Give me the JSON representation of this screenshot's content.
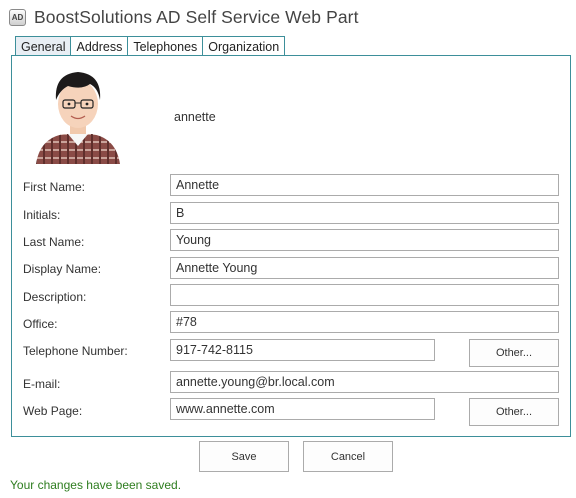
{
  "window": {
    "icon": "app-icon",
    "icon_text": "AD",
    "title": "BoostSolutions AD Self Service Web Part"
  },
  "tabs": [
    {
      "label": "General",
      "active": true
    },
    {
      "label": "Address",
      "active": false
    },
    {
      "label": "Telephones",
      "active": false
    },
    {
      "label": "Organization",
      "active": false
    }
  ],
  "profile": {
    "photo": "user-photo",
    "username": "annette"
  },
  "form": {
    "first_name": {
      "label": "First Name:",
      "value": "Annette"
    },
    "initials": {
      "label": "Initials:",
      "value": "B"
    },
    "last_name": {
      "label": "Last Name:",
      "value": "Young"
    },
    "display_name": {
      "label": "Display Name:",
      "value": "Annette Young"
    },
    "description": {
      "label": "Description:",
      "value": ""
    },
    "office": {
      "label": "Office:",
      "value": "#78"
    },
    "telephone": {
      "label": "Telephone Number:",
      "value": "917-742-8115"
    },
    "email": {
      "label": "E-mail:",
      "value": "annette.young@br.local.com"
    },
    "web_page": {
      "label": "Web Page:",
      "value": "www.annette.com"
    },
    "other_label": "Other..."
  },
  "actions": {
    "save_label": "Save",
    "cancel_label": "Cancel"
  },
  "status": {
    "message": "Your changes have been saved.",
    "color": "#2e7d1f"
  },
  "colors": {
    "panel_border": "#3d8f9a",
    "active_tab_bg": "#e8eef4"
  }
}
